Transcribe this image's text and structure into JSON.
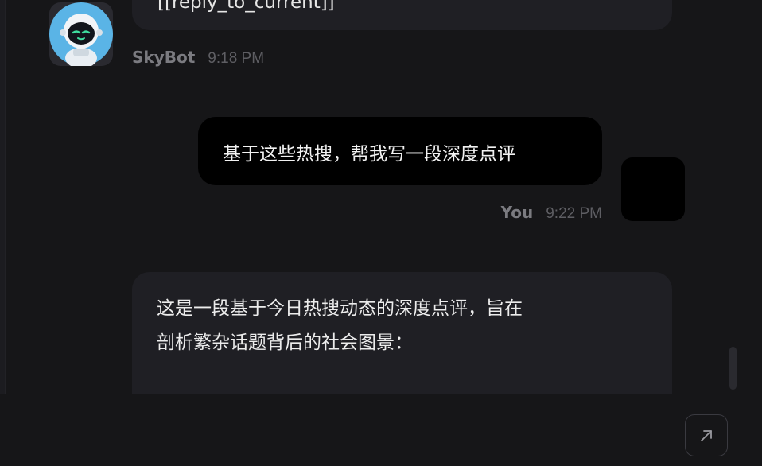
{
  "messages": [
    {
      "role": "bot",
      "text_clipped": "[[reply_to_current]]",
      "sender": "SkyBot",
      "time": "9:18 PM",
      "avatar_icon": "robot-avatar-icon"
    },
    {
      "role": "user",
      "text": "基于这些热搜，帮我写一段深度点评",
      "sender": "You",
      "time": "9:22 PM"
    },
    {
      "role": "bot",
      "lines": [
        "这是一段基于今日热搜动态的深度点评，旨在",
        "剖析繁杂话题背后的社会图景："
      ]
    }
  ],
  "controls": {
    "jump_icon": "arrow-up-right-icon"
  },
  "colors": {
    "background": "#161618",
    "bot_bubble": "#1f1f24",
    "user_bubble": "#000000",
    "avatar_bg": "#5ab4e6"
  }
}
